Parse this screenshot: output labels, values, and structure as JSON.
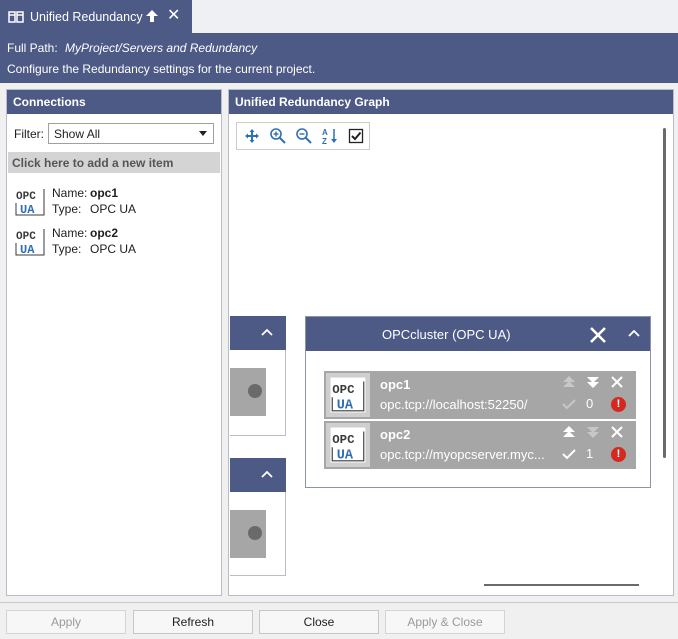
{
  "tab": {
    "title": "Unified Redundancy"
  },
  "header": {
    "path_label": "Full Path:",
    "path_value": "MyProject/Servers and Redundancy",
    "description": "Configure the Redundancy settings for the current project."
  },
  "connections": {
    "title": "Connections",
    "filter_label": "Filter:",
    "filter_value": "Show All",
    "add_item": "Click here to add a new item",
    "name_label": "Name:",
    "type_label": "Type:",
    "items": [
      {
        "name": "opc1",
        "type": "OPC UA"
      },
      {
        "name": "opc2",
        "type": "OPC UA"
      }
    ]
  },
  "graph": {
    "title": "Unified Redundancy Graph",
    "cluster": {
      "title": "OPCcluster (OPC UA)",
      "servers": [
        {
          "name": "opc1",
          "url": "opc.tcp://localhost:52250/",
          "priority": "0"
        },
        {
          "name": "opc2",
          "url": "opc.tcp://myopcserver.myc...",
          "priority": "1"
        }
      ]
    }
  },
  "footer": {
    "apply": "Apply",
    "refresh": "Refresh",
    "close": "Close",
    "apply_close": "Apply & Close"
  },
  "colors": {
    "header_bg": "#4d5a86",
    "server_bg": "#a6a6a6",
    "error": "#d6281e"
  },
  "icons": [
    "split-view-icon",
    "move-up-icon",
    "close-icon",
    "pan-icon",
    "zoom-in-icon",
    "zoom-out-icon",
    "sort-icon",
    "checkbox-icon",
    "opc-ua-logo",
    "chevron-up-icon",
    "arrow-up-icon",
    "arrow-down-icon",
    "remove-icon",
    "check-icon",
    "error-icon"
  ]
}
